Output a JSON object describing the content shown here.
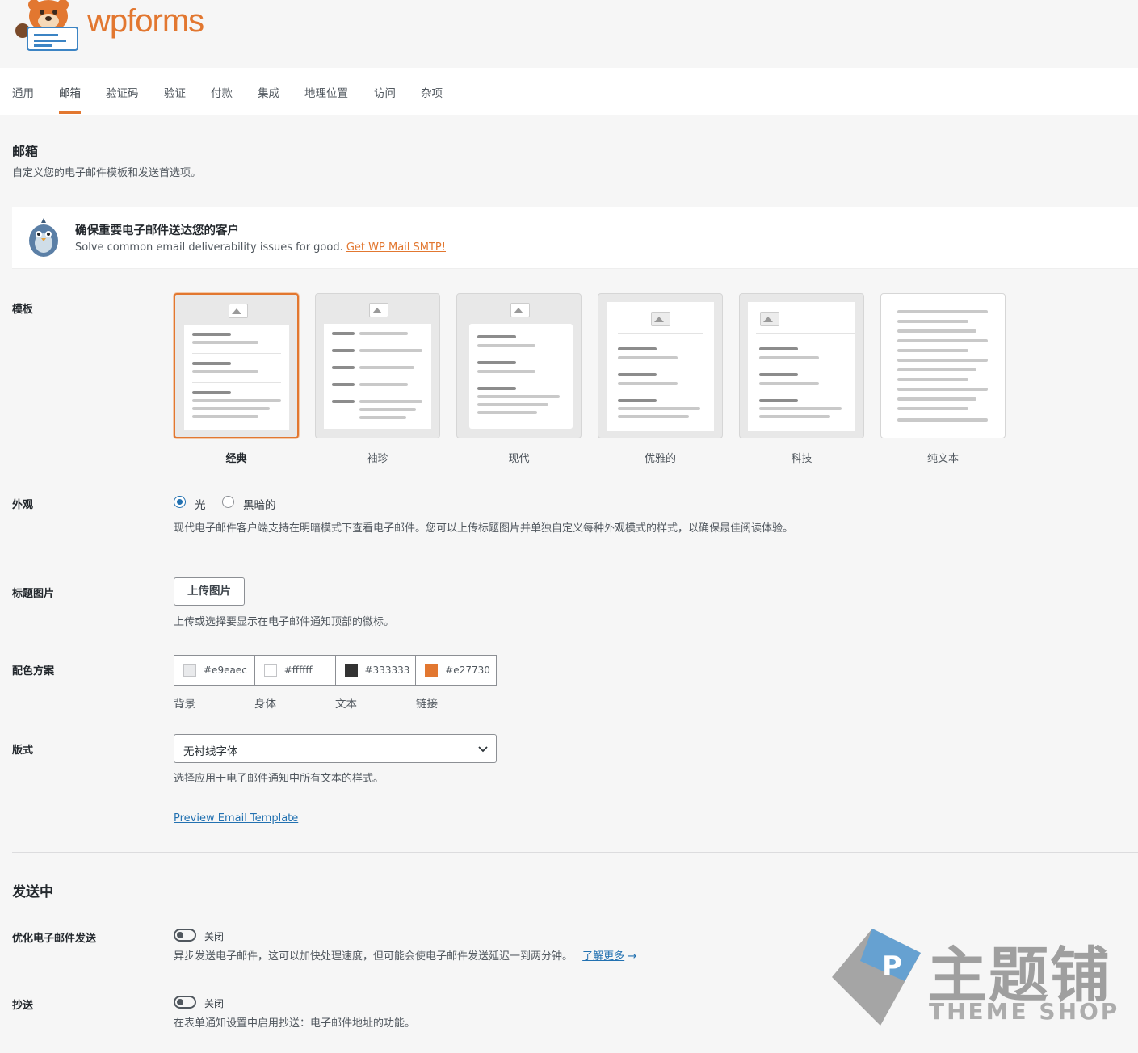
{
  "brand": {
    "name": "wpforms"
  },
  "tabs": [
    "通用",
    "邮箱",
    "验证码",
    "验证",
    "付款",
    "集成",
    "地理位置",
    "访问",
    "杂项"
  ],
  "email_section": {
    "title": "邮箱",
    "description": "自定义您的电子邮件模板和发送首选项。"
  },
  "banner": {
    "title": "确保重要电子邮件送达您的客户",
    "subtitle": "Solve common email deliverability issues for good.",
    "link": "Get WP Mail SMTP!"
  },
  "template": {
    "label": "模板",
    "options": [
      "经典",
      "袖珍",
      "现代",
      "优雅的",
      "科技",
      "纯文本"
    ],
    "selected": "经典"
  },
  "appearance": {
    "label": "外观",
    "options": [
      "光",
      "黑暗的"
    ],
    "selected": "光",
    "description": "现代电子邮件客户端支持在明暗模式下查看电子邮件。您可以上传标题图片并单独自定义每种外观模式的样式，以确保最佳阅读体验。"
  },
  "header_image": {
    "label": "标题图片",
    "button": "上传图片",
    "description": "上传或选择要显示在电子邮件通知顶部的徽标。"
  },
  "color_scheme": {
    "label": "配色方案",
    "colors": [
      {
        "hex": "#e9eaec",
        "label": "背景"
      },
      {
        "hex": "#ffffff",
        "label": "身体"
      },
      {
        "hex": "#333333",
        "label": "文本"
      },
      {
        "hex": "#e27730",
        "label": "链接"
      }
    ]
  },
  "typography": {
    "label": "版式",
    "value": "无衬线字体",
    "description": "选择应用于电子邮件通知中所有文本的样式。"
  },
  "preview_link": "Preview Email Template",
  "sending": {
    "title": "发送中",
    "optimize": {
      "label": "优化电子邮件发送",
      "state": "关闭",
      "description": "异步发送电子邮件，这可以加快处理速度，但可能会使电子邮件发送延迟一到两分钟。",
      "learn_more": "了解更多"
    },
    "cc": {
      "label": "抄送",
      "state": "关闭",
      "description": "在表单通知设置中启用抄送：电子邮件地址的功能。"
    }
  },
  "watermark": {
    "text": "主题铺",
    "sub": "THEME SHOP"
  },
  "colors": {
    "accent": "#e27730",
    "link": "#2271b1"
  }
}
